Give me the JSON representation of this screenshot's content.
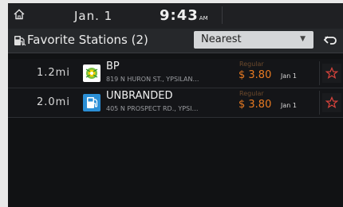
{
  "statusbar": {
    "home_icon": "home-icon",
    "date": "Jan.  1",
    "time": "9:43",
    "ampm": "AM"
  },
  "header": {
    "title": "Favorite Stations (2)",
    "title_icon": "gas-station-icon",
    "sort": {
      "selected": "Nearest"
    },
    "back_icon": "back-icon"
  },
  "stations": [
    {
      "distance": "1.2mi",
      "name": "BP",
      "address": "819 N HURON ST., YPSILAN…",
      "fuel_type": "Regular",
      "price": "$ 3.80",
      "date": "Jan 1",
      "logo": "bp-logo",
      "logo_color": "#7ac142",
      "favorite_icon": "star-icon"
    },
    {
      "distance": "2.0mi",
      "name": "UNBRANDED",
      "address": "405 N PROSPECT RD., YPSI…",
      "fuel_type": "Regular",
      "price": "$ 3.80",
      "date": "Jan 1",
      "logo": "fuel-pump-icon",
      "logo_color": "#2b8fd6",
      "favorite_icon": "star-icon"
    }
  ],
  "colors": {
    "accent_orange": "#e87a22",
    "star_red": "#d8433c"
  }
}
